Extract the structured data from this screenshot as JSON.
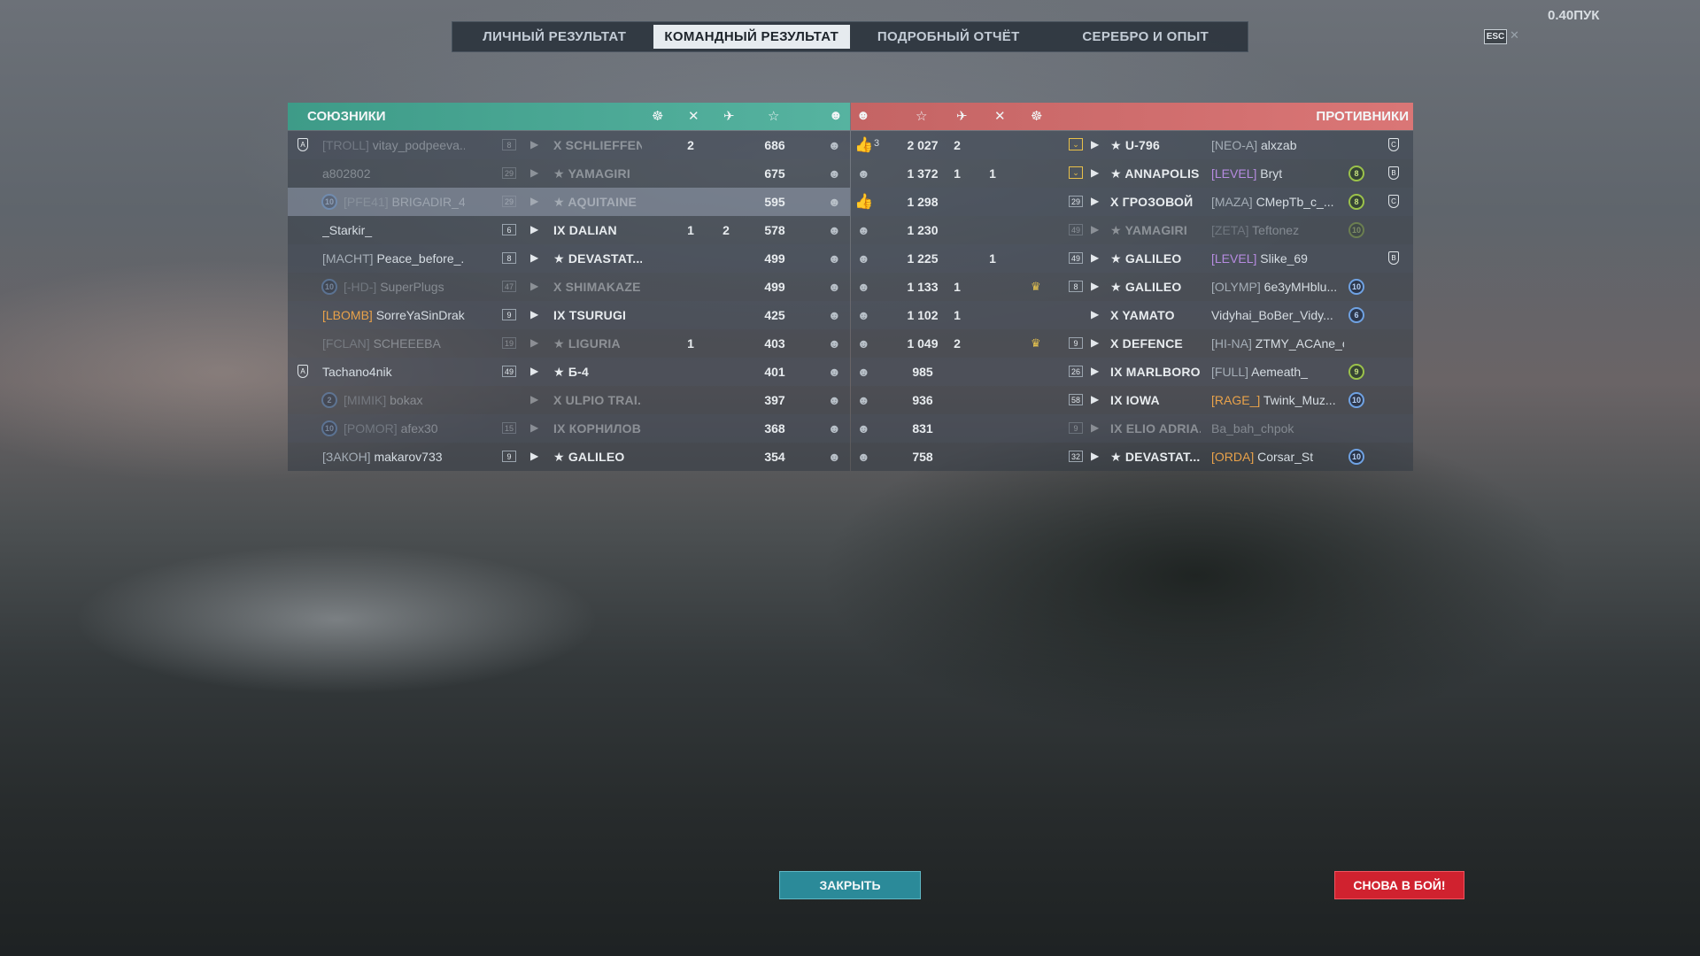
{
  "tabs": [
    {
      "label": "ЛИЧНЫЙ РЕЗУЛЬТАТ"
    },
    {
      "label": "КОМАНДНЫЙ РЕЗУЛЬТАТ"
    },
    {
      "label": "ПОДРОБНЫЙ ОТЧЁТ"
    },
    {
      "label": "СЕРЕБРО И ОПЫТ"
    }
  ],
  "active_tab": "КОМАНДНЫЙ РЕЗУЛЬТАТ",
  "points_label": "0.40ПУК",
  "esc_label": "ESC",
  "allies": {
    "title": "СОЮЗНИКИ",
    "header_icons": [
      "ship-kill-icon",
      "plane-kill-icon",
      "plane-icon",
      "star-icon",
      "smiley-icon"
    ],
    "rows": [
      {
        "mark": "A",
        "clan": "[TROLL]",
        "name": "vitay_podpeeva...",
        "level": "8",
        "ship": "X SCHLIEFFEN",
        "ship_prefixed_star": false,
        "kills": "2",
        "planes": "",
        "xp": "686",
        "dim": true
      },
      {
        "mark": "",
        "clan": "",
        "name": "a802802",
        "level": "29",
        "ship": "YAMAGIRI",
        "ship_prefixed_star": true,
        "kills": "",
        "planes": "",
        "xp": "675",
        "dim": true
      },
      {
        "mark": "",
        "badge": "10",
        "clan": "[PFE41]",
        "name": "BRIGADIR_4...",
        "level": "29",
        "ship": "AQUITAINE",
        "ship_prefixed_star": true,
        "kills": "",
        "planes": "",
        "xp": "595",
        "dim": true,
        "selected": true
      },
      {
        "mark": "",
        "clan": "",
        "name": "_Starkir_",
        "level": "6",
        "ship": "IX DALIAN",
        "ship_prefixed_star": false,
        "kills": "1",
        "planes": "2",
        "xp": "578",
        "dim": false
      },
      {
        "mark": "",
        "clan": "[MACHT]",
        "name": "Peace_before_...",
        "level": "8",
        "ship": "DEVASTAT...",
        "ship_prefixed_star": true,
        "kills": "",
        "planes": "",
        "xp": "499",
        "dim": false
      },
      {
        "mark": "",
        "badge": "10",
        "clan": "[-HD-]",
        "name": "SuperPlugs",
        "level": "47",
        "ship": "X SHIMAKAZE",
        "ship_prefixed_star": false,
        "kills": "",
        "planes": "",
        "xp": "499",
        "dim": true
      },
      {
        "mark": "",
        "clan": "[LBOMB]",
        "clan_color": "orange",
        "name": "SorreYaSinDrak...",
        "level": "9",
        "ship": "IX TSURUGI",
        "ship_prefixed_star": false,
        "kills": "",
        "planes": "",
        "xp": "425",
        "dim": false
      },
      {
        "mark": "",
        "clan": "[FCLAN]",
        "name": "SCHEEEBA",
        "level": "19",
        "ship": "LIGURIA",
        "ship_prefixed_star": true,
        "kills": "1",
        "planes": "",
        "xp": "403",
        "dim": true
      },
      {
        "mark": "A",
        "clan": "",
        "name": "Tachano4nik",
        "level": "49",
        "ship": "Б-4",
        "ship_prefixed_star": true,
        "kills": "",
        "planes": "",
        "xp": "401",
        "dim": false
      },
      {
        "mark": "",
        "badge": "2",
        "clan": "[MIMIK]",
        "name": "bokax",
        "level": "",
        "ship": "X ULPIO TRAI...",
        "ship_prefixed_star": false,
        "kills": "",
        "planes": "",
        "xp": "397",
        "dim": true
      },
      {
        "mark": "",
        "badge": "10",
        "clan": "[POMOR]",
        "name": "afex30",
        "level": "15",
        "ship": "IX КОРНИЛОВ",
        "ship_prefixed_star": false,
        "kills": "",
        "planes": "",
        "xp": "368",
        "dim": true
      },
      {
        "mark": "",
        "clan": "[ЗАКОН]",
        "name": "makarov733",
        "level": "9",
        "ship": "GALILEO",
        "ship_prefixed_star": true,
        "kills": "",
        "planes": "",
        "xp": "354",
        "dim": false
      }
    ]
  },
  "enemies": {
    "title": "ПРОТИВНИКИ",
    "header_icons": [
      "smiley-icon",
      "star-icon",
      "plane-icon",
      "plane-kill-icon",
      "ship-kill-icon"
    ],
    "rows": [
      {
        "thumb": "3",
        "xp": "2 027",
        "kills_a": "2",
        "kills_b": "",
        "crown": false,
        "level": "",
        "ship": "U-796",
        "ship_prefixed_star": true,
        "clan": "[NEO-A]",
        "name": "alxzab",
        "dim": false
      },
      {
        "thumb": "",
        "xp": "1 372",
        "kills_a": "1",
        "kills_b": "1",
        "crown": false,
        "level": "",
        "ship": "ANNAPOLIS",
        "ship_prefixed_star": true,
        "clan": "[LEVEL]",
        "clan_color": "purple",
        "name": "Bryt",
        "badge": "8",
        "dim": false
      },
      {
        "thumb": "",
        "xp": "1 298",
        "kills_a": "",
        "kills_b": "",
        "crown": false,
        "level": "29",
        "ship": "X ГРОЗОВОЙ",
        "ship_prefixed_star": false,
        "clan": "[MAZA]",
        "name": "CMepTb_c_...",
        "badge": "8",
        "dim": false
      },
      {
        "thumb": "",
        "xp": "1 230",
        "kills_a": "",
        "kills_b": "",
        "crown": false,
        "level": "49",
        "ship": "YAMAGIRI",
        "ship_prefixed_star": true,
        "clan": "[ZETA]",
        "name": "Teftonez",
        "badge": "10",
        "dim": true
      },
      {
        "thumb": "",
        "xp": "1 225",
        "kills_a": "",
        "kills_b": "1",
        "crown": false,
        "level": "49",
        "ship": "GALILEO",
        "ship_prefixed_star": true,
        "clan": "[LEVEL]",
        "clan_color": "purple",
        "name": "Slike_69",
        "dim": false
      },
      {
        "thumb": "",
        "xp": "1 133",
        "kills_a": "1",
        "kills_b": "",
        "crown": true,
        "level": "8",
        "ship": "GALILEO",
        "ship_prefixed_star": true,
        "clan": "[OLYMP]",
        "name": "6e3yMHblu...",
        "badge": "10",
        "dim": false
      },
      {
        "thumb": "",
        "xp": "1 102",
        "kills_a": "1",
        "kills_b": "",
        "crown": false,
        "level": "",
        "ship": "X YAMATO",
        "ship_prefixed_star": false,
        "clan": "",
        "name": "Vidyhai_BoBer_Vidy...",
        "badge": "6",
        "dim": false
      },
      {
        "thumb": "",
        "xp": "1 049",
        "kills_a": "2",
        "kills_b": "",
        "crown": true,
        "level": "9",
        "ship": "X DEFENCE",
        "ship_prefixed_star": false,
        "clan": "[HI-NA]",
        "name": "ZTMY_ACAne_of...",
        "dim": false
      },
      {
        "thumb": "",
        "xp": "985",
        "kills_a": "",
        "kills_b": "",
        "crown": false,
        "level": "26",
        "ship": "IX MARLBORO...",
        "ship_prefixed_star": false,
        "clan": "[FULL]",
        "name": "Aemeath_",
        "badge": "9",
        "dim": false
      },
      {
        "thumb": "",
        "xp": "936",
        "kills_a": "",
        "kills_b": "",
        "crown": false,
        "level": "58",
        "ship": "IX IOWA",
        "ship_prefixed_star": false,
        "clan": "[RAGE_]",
        "clan_color": "orange",
        "name": "Twink_Muz...",
        "badge": "10",
        "dim": false
      },
      {
        "thumb": "",
        "xp": "831",
        "kills_a": "",
        "kills_b": "",
        "crown": false,
        "level": "9",
        "ship": "IX ELIO ADRIA...",
        "ship_prefixed_star": false,
        "clan": "",
        "name": "Ba_bah_chpok",
        "dim": true
      },
      {
        "thumb": "",
        "xp": "758",
        "kills_a": "",
        "kills_b": "",
        "crown": false,
        "level": "32",
        "ship": "DEVASTAT...",
        "ship_prefixed_star": true,
        "clan": "[ORDA]",
        "clan_color": "orange",
        "name": "Corsar_St",
        "badge": "10",
        "dim": false
      }
    ]
  },
  "buttons": {
    "close": "ЗАКРЫТЬ",
    "battle": "СНОВА В БОЙ!"
  },
  "colors": {
    "ally_header": "#4fae9b",
    "enemy_header": "#d06f6f",
    "close_button": "#2b8a99",
    "battle_button": "#d0222f"
  }
}
